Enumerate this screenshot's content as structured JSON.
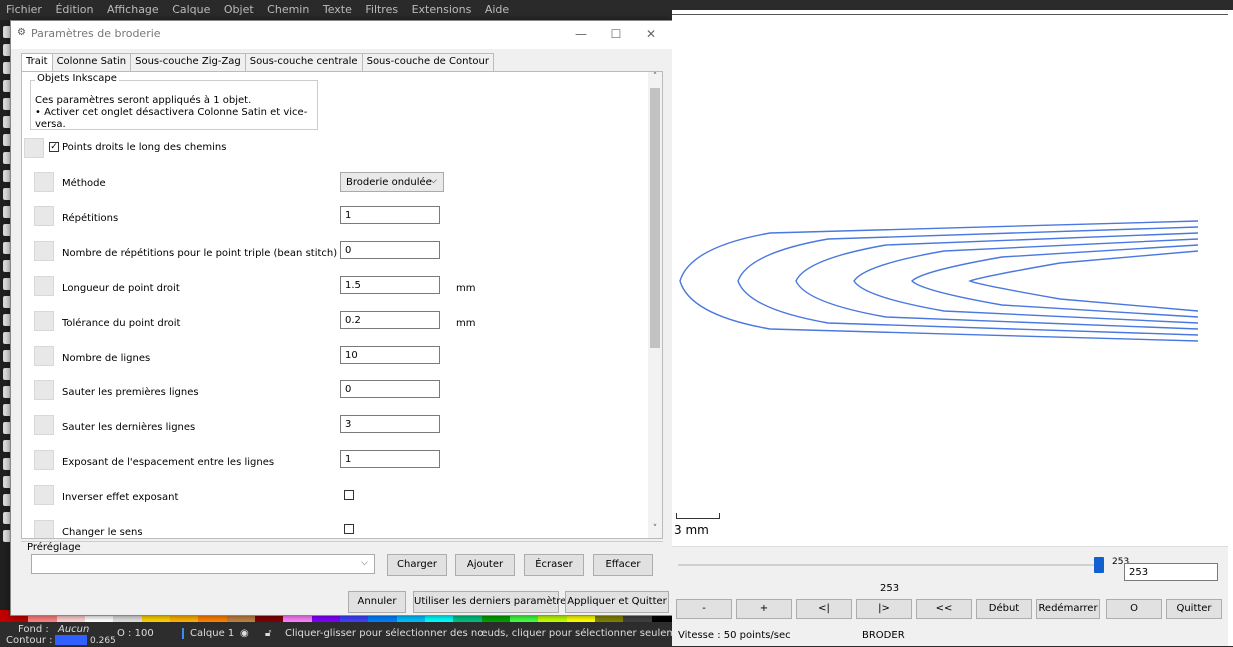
{
  "inkscape": {
    "menu": [
      "Fichier",
      "Édition",
      "Affichage",
      "Calque",
      "Objet",
      "Chemin",
      "Texte",
      "Filtres",
      "Extensions",
      "Aide"
    ],
    "status": {
      "fill_label": "Fond :",
      "fill_value": "Aucun",
      "stroke_label": "Contour :",
      "stroke_width": "0.265",
      "opacity": "O : 100",
      "layer": "Calque 1",
      "message": "Cliquer-glisser pour sélectionner des nœuds, cliquer pour sélectionner seulement cet ob"
    },
    "palette": [
      "#c00000",
      "#ff8080",
      "#ffd0d0",
      "#ffffff",
      "#e0e0e0",
      "#ffd000",
      "#ffb000",
      "#ff8000",
      "#c08040",
      "#800000",
      "#ff80ff",
      "#8000ff",
      "#4040ff",
      "#0080ff",
      "#00c0ff",
      "#00ffff",
      "#00c080",
      "#00a000",
      "#40ff40",
      "#c0ff00",
      "#ffff00",
      "#808000",
      "#404040",
      "#000000"
    ]
  },
  "dialog": {
    "title": "Paramètres de broderie",
    "tabs": [
      "Trait",
      "Colonne Satin",
      "Sous-couche Zig-Zag",
      "Sous-couche centrale",
      "Sous-couche de Contour"
    ],
    "group_title": "Objets Inkscape",
    "group_line1": "Ces paramètres seront appliqués à 1 objet.",
    "group_line2": "• Activer cet onglet désactivera Colonne Satin et vice-versa.",
    "enable_label": "Points droits le long des chemins",
    "params": {
      "method_label": "Méthode",
      "method_value": "Broderie ondulée",
      "repeats_label": "Répétitions",
      "repeats_value": "1",
      "bean_label": "Nombre de répétitions pour le point triple (bean stitch)",
      "bean_value": "0",
      "length_label": "Longueur de point droit",
      "length_value": "1.5",
      "length_unit": "mm",
      "tolerance_label": "Tolérance du point droit",
      "tolerance_value": "0.2",
      "tolerance_unit": "mm",
      "lines_label": "Nombre de lignes",
      "lines_value": "10",
      "skip_first_label": "Sauter les premières lignes",
      "skip_first_value": "0",
      "skip_last_label": "Sauter les dernières lignes",
      "skip_last_value": "3",
      "exponent_label": "Exposant de l'espacement entre les lignes",
      "exponent_value": "1",
      "invert_label": "Inverser effet exposant",
      "reverse_label": "Changer le sens"
    },
    "preset_label": "Préréglage",
    "buttons": {
      "load": "Charger",
      "add": "Ajouter",
      "overwrite": "Écraser",
      "delete": "Effacer",
      "cancel": "Annuler",
      "use_last": "Utiliser les derniers paramètres",
      "apply_quit": "Appliquer et Quitter"
    }
  },
  "simulator": {
    "scale_label": "3 mm",
    "slider_small": "253",
    "slider_value": "253",
    "frame_label": "253",
    "controls": [
      "-",
      "+",
      "<|",
      "|>",
      "<<",
      "Début",
      "Redémarrer",
      "O",
      "Quitter"
    ],
    "speed": "Vitesse : 50 points/sec",
    "command": "BRODER",
    "stroke_color": "#4a78e0"
  }
}
